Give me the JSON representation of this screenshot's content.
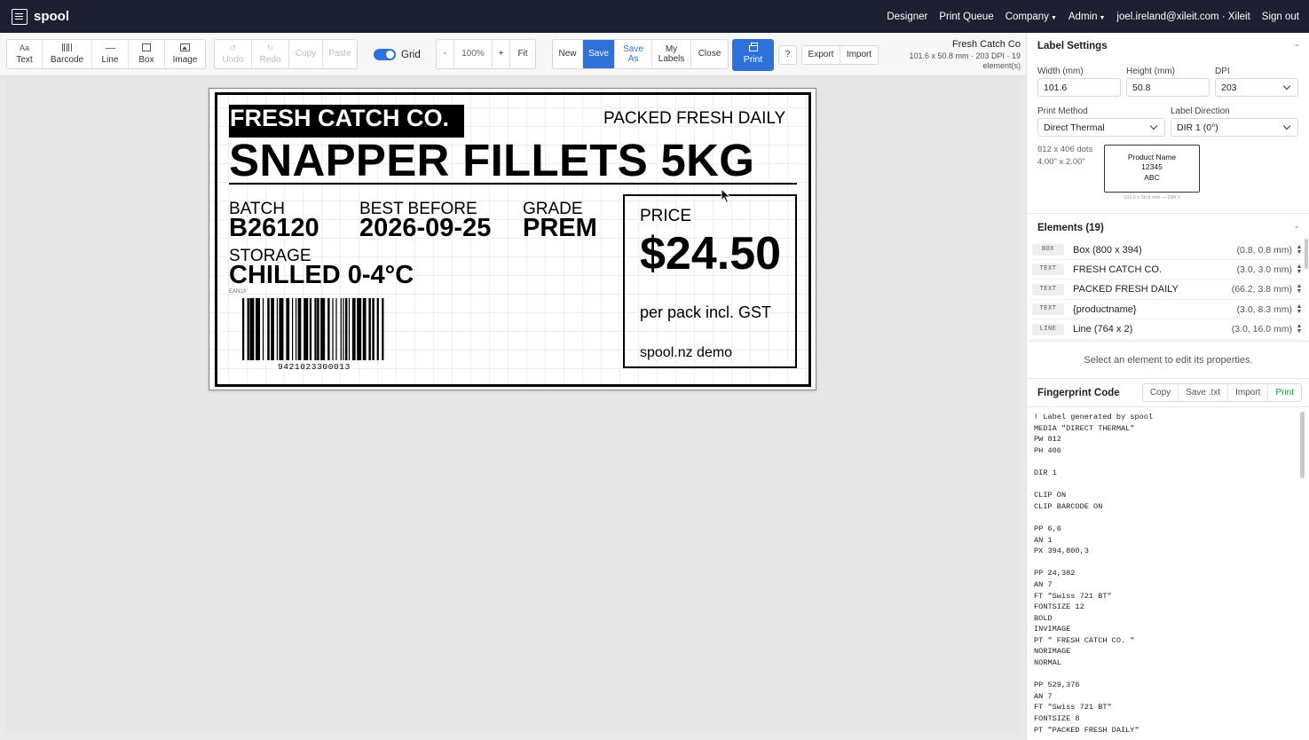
{
  "brand": {
    "name": "spool"
  },
  "nav": {
    "designer": "Designer",
    "print_queue": "Print Queue",
    "company": "Company",
    "admin": "Admin",
    "user": "joel.ireland@xileit.com · Xileit",
    "sign_out": "Sign out"
  },
  "toolbar": {
    "text": "Text",
    "text_icon": "Aa",
    "barcode": "Barcode",
    "line": "Line",
    "box": "Box",
    "image": "Image",
    "undo": "Undo",
    "redo": "Redo",
    "copy": "Copy",
    "paste": "Paste",
    "grid": "Grid",
    "zoom_minus": "-",
    "zoom": "100%",
    "zoom_plus": "+",
    "fit": "Fit",
    "new": "New",
    "save": "Save",
    "save_as_1": "Save",
    "save_as_2": "As",
    "my_labels_1": "My",
    "my_labels_2": "Labels",
    "close": "Close",
    "print": "Print",
    "help": "?",
    "export": "Export",
    "import": "Import"
  },
  "label_info": {
    "name": "Fresh Catch Co",
    "details": "101.6 x 50.8 mm · 203 DPI · 19",
    "details2": "element(s)"
  },
  "label": {
    "brand": "FRESH CATCH CO.",
    "tagline": "PACKED FRESH DAILY",
    "product": "SNAPPER FILLETS 5KG",
    "batch_label": "BATCH",
    "batch_value": "B26120",
    "best_before_label": "BEST BEFORE",
    "best_before_value": "2026-09-25",
    "grade_label": "GRADE",
    "grade_value": "PREM",
    "storage_label": "STORAGE",
    "storage_value": "CHILLED 0-4°C",
    "barcode_type": "EAN13",
    "barcode_number": "9421023300013",
    "price_label": "PRICE",
    "price_value": "$24.50",
    "price_note": "per pack incl. GST",
    "footer": "spool.nz demo"
  },
  "settings": {
    "title": "Label Settings",
    "collapse": "-",
    "width_label": "Width (mm)",
    "width_value": "101.6",
    "height_label": "Height (mm)",
    "height_value": "50.8",
    "dpi_label": "DPI",
    "dpi_value": "203",
    "print_method_label": "Print Method",
    "print_method_value": "Direct Thermal",
    "direction_label": "Label Direction",
    "direction_value": "DIR 1 (0°)",
    "dots": "812 x 406 dots",
    "inches": "4.00\" x 2.00\"",
    "preview_line1": "Product Name",
    "preview_line2": "12345",
    "preview_line3": "ABC",
    "preview_caption": "101.6 x 50.8 mm — DIR 1"
  },
  "elements": {
    "title": "Elements (19)",
    "collapse": "-",
    "items": [
      {
        "type": "BOX",
        "name": "Box (800 x 394)",
        "pos": "(0.8, 0.8 mm)"
      },
      {
        "type": "TEXT",
        "name": "FRESH CATCH CO.",
        "pos": "(3.0, 3.0 mm)"
      },
      {
        "type": "TEXT",
        "name": "PACKED FRESH DAILY",
        "pos": "(66.2, 3.8 mm)"
      },
      {
        "type": "TEXT",
        "name": "{productname}",
        "pos": "(3.0, 8.3 mm)"
      },
      {
        "type": "LINE",
        "name": "Line (764 x 2)",
        "pos": "(3.0, 16.0 mm)"
      }
    ],
    "hint": "Select an element to edit its properties."
  },
  "fingerprint": {
    "title": "Fingerprint Code",
    "copy": "Copy",
    "save_txt": "Save .txt",
    "import": "Import",
    "print": "Print",
    "code": "! Label generated by spool\nMEDIA \"DIRECT THERMAL\"\nPW 812\nPH 406\n\nDIR 1\n\nCLIP ON\nCLIP BARCODE ON\n\nPP 6,6\nAN 1\nPX 394,800,3\n\nPP 24,382\nAN 7\nFT \"Swiss 721 BT\"\nFONTSIZE 12\nBOLD\nINVIMAGE\nPT \" FRESH CATCH CO. \"\nNORIMAGE\nNORMAL\n\nPP 529,376\nAN 7\nFT \"Swiss 721 BT\"\nFONTSIZE 8\nPT \"PACKED FRESH DAILY\""
  }
}
